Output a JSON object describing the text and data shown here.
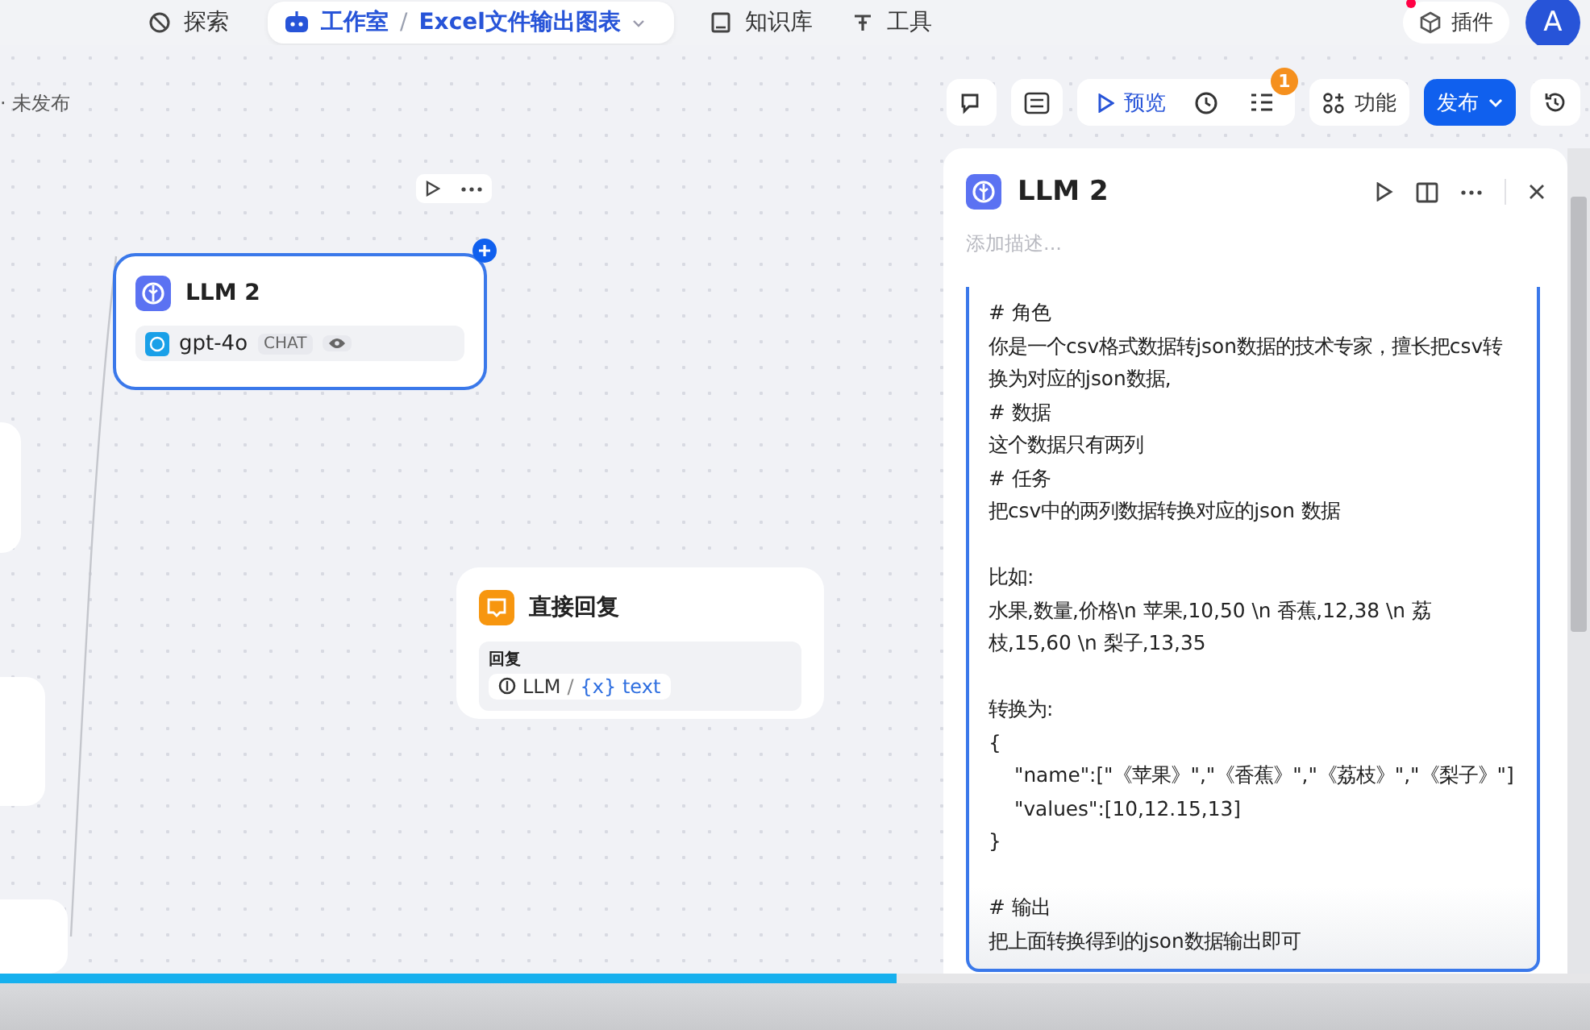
{
  "nav": {
    "items": [
      {
        "kind": "link",
        "label": "探索"
      },
      {
        "kind": "crumb",
        "label": "工作室",
        "separator": "/",
        "project": "Excel文件输出图表",
        "selected": true
      },
      {
        "kind": "link",
        "label": "知识库"
      },
      {
        "kind": "link",
        "label": "工具"
      }
    ],
    "plugin": "插件",
    "avatar": "A"
  },
  "status": "· 未发布",
  "toolbar": {
    "preview": "预览",
    "badge": "1",
    "features": "功能",
    "publish": "发布"
  },
  "nodes": [
    {
      "kind": "llm",
      "title": "LLM 2",
      "selected": true,
      "model": "gpt-4o",
      "tag": "CHAT"
    },
    {
      "kind": "reply",
      "title": "直接回复",
      "selected": false,
      "field": "回复",
      "source": "LLM",
      "separator": "/",
      "var_glyph": "{x}",
      "var": "text"
    }
  ],
  "panel": {
    "title": "LLM 2",
    "placeholder": "添加描述...",
    "prompt": [
      [
        {
          "text": "# 角色",
          "indented": false
        },
        {
          "text": "你是一个csv格式数据转json数据的技术专家，擅长把csv转换为对应的json数据,",
          "indented": false
        },
        {
          "text": "# 数据",
          "indented": false
        },
        {
          "text": "这个数据只有两列",
          "indented": false
        },
        {
          "text": "# 任务",
          "indented": false
        },
        {
          "text": "把csv中的两列数据转换对应的json 数据",
          "indented": false
        }
      ],
      [
        {
          "text": "比如:",
          "indented": false
        },
        {
          "text": "水果,数量,价格\\n 苹果,10,50 \\n 香蕉,12,38 \\n 荔枝,15,60 \\n 梨子,13,35",
          "indented": false
        }
      ],
      [
        {
          "text": "转换为:",
          "indented": false
        },
        {
          "text": "{",
          "indented": false
        },
        {
          "text": "\"name\":[\"《苹果》\",\"《香蕉》\",\"《荔枝》\",\"《梨子》\"]",
          "indented": true
        },
        {
          "text": "\"values\":[10,12.15,13]",
          "indented": true
        },
        {
          "text": "}",
          "indented": false
        }
      ],
      [
        {
          "text": "# 输出",
          "indented": false
        },
        {
          "text": "把上面转换得到的json数据输出即可",
          "indented": false
        }
      ]
    ]
  },
  "video": {
    "level": 0.564
  }
}
